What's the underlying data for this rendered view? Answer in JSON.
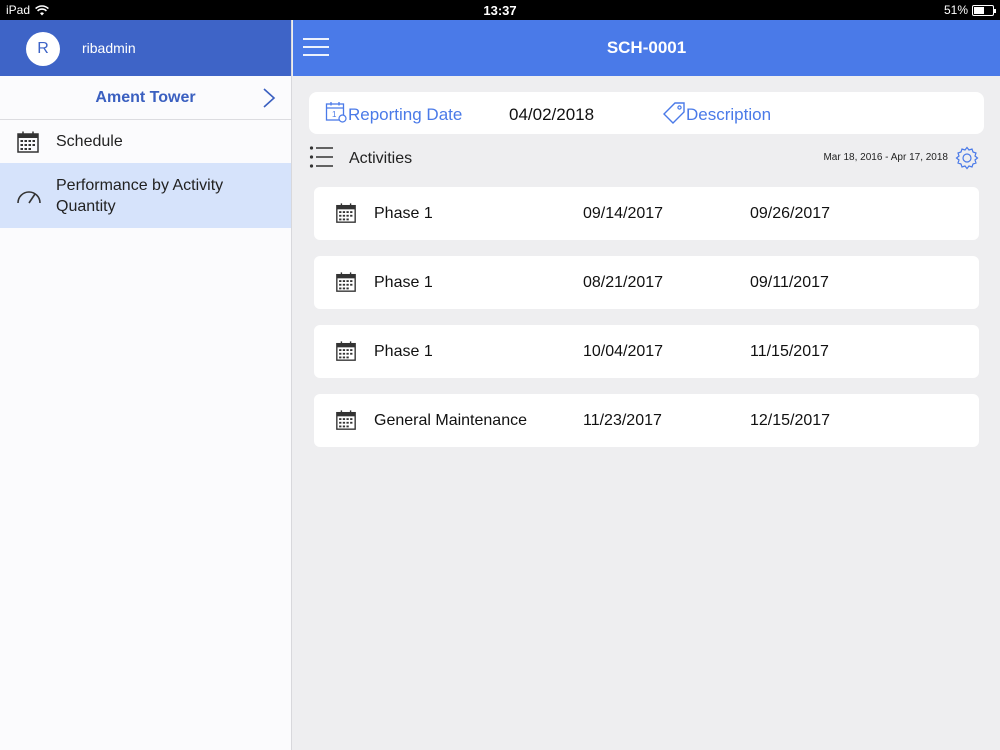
{
  "status_bar": {
    "device": "iPad",
    "time": "13:37",
    "battery": "51%",
    "battery_level": 0.51
  },
  "sidebar": {
    "avatar_initial": "R",
    "username": "ribadmin",
    "project": "Ament Tower",
    "items": [
      {
        "label": "Schedule",
        "icon": "calendar-icon"
      },
      {
        "label": "Performance by Activity Quantity",
        "icon": "speedometer-icon",
        "selected": true
      }
    ]
  },
  "header": {
    "title": "SCH-0001"
  },
  "report": {
    "date_label": "Reporting Date",
    "date_value": "04/02/2018",
    "description_label": "Description"
  },
  "activities": {
    "label": "Activities",
    "range": "Mar 18, 2016 - Apr 17, 2018",
    "rows": [
      {
        "name": "Phase 1",
        "start": "09/14/2017",
        "end": "09/26/2017"
      },
      {
        "name": "Phase 1",
        "start": "08/21/2017",
        "end": "09/11/2017"
      },
      {
        "name": "Phase 1",
        "start": "10/04/2017",
        "end": "11/15/2017"
      },
      {
        "name": "General Maintenance",
        "start": "11/23/2017",
        "end": "12/15/2017"
      }
    ]
  },
  "colors": {
    "sidebar_header": "#3e64c7",
    "topbar": "#4a7ae8",
    "accent": "#4a7ae8",
    "selected_bg": "#d6e3fb"
  }
}
